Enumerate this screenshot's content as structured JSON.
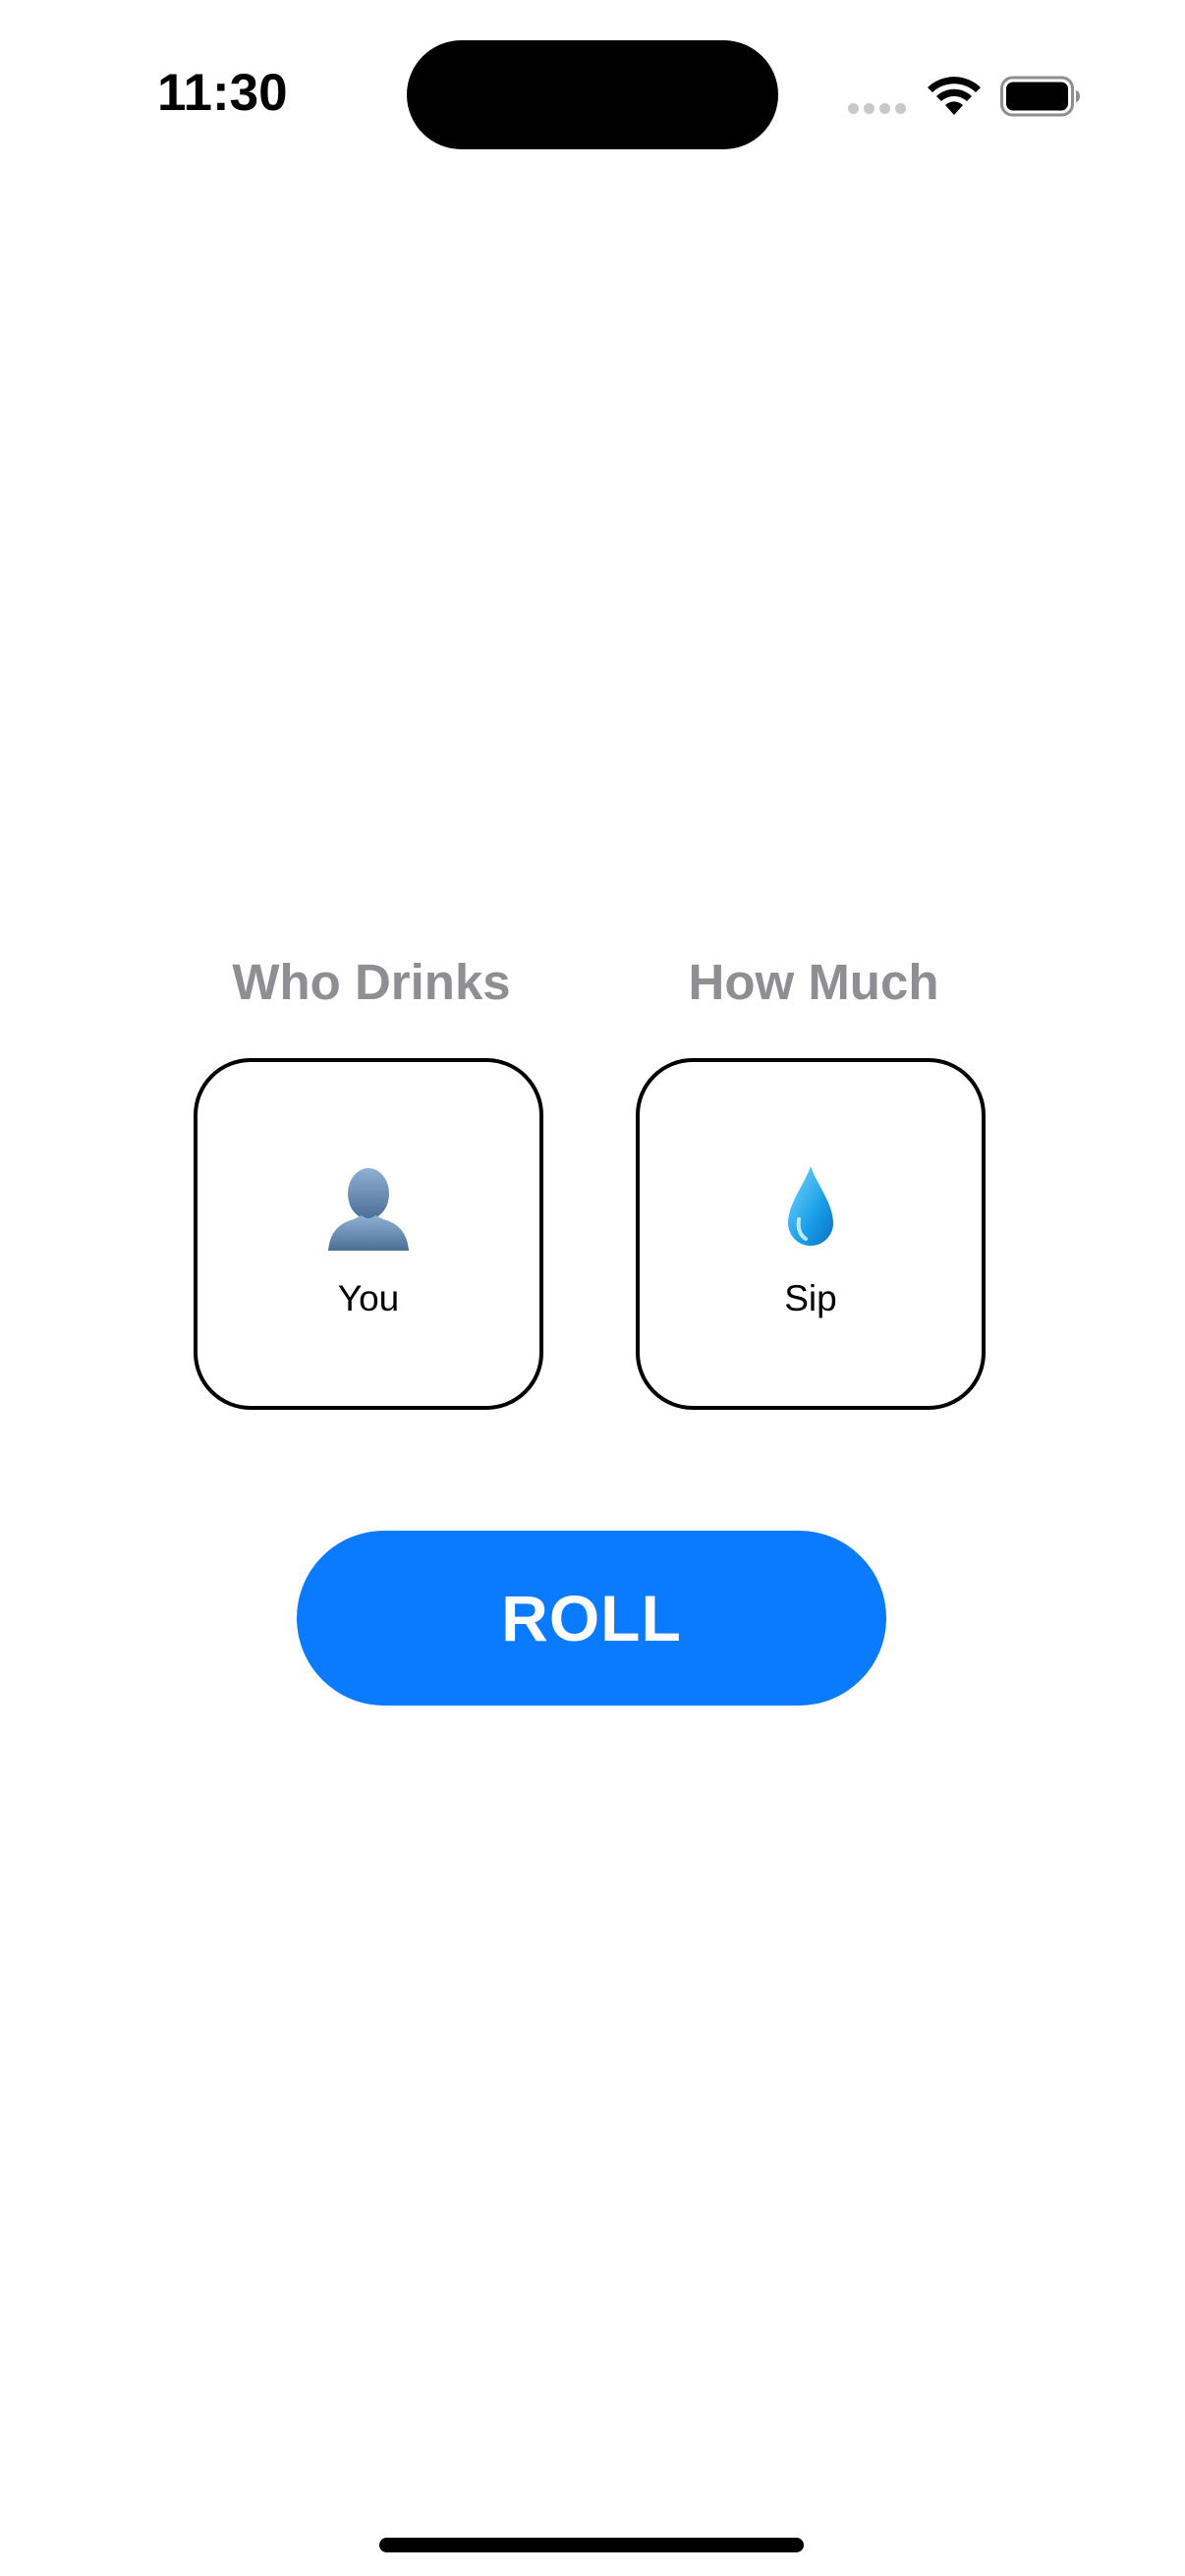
{
  "status_bar": {
    "time": "11:30",
    "wifi_icon": "wifi-icon",
    "battery_icon": "battery-full-icon"
  },
  "columns": [
    {
      "label": "Who Drinks",
      "value": "You",
      "icon": "person-silhouette-icon"
    },
    {
      "label": "How Much",
      "value": "Sip",
      "icon": "water-droplet-icon"
    }
  ],
  "roll_button": {
    "label": "ROLL"
  },
  "colors": {
    "accent": "#0a7aff",
    "label_gray": "#8e8e93",
    "card_border": "#000000",
    "background": "#ffffff"
  }
}
